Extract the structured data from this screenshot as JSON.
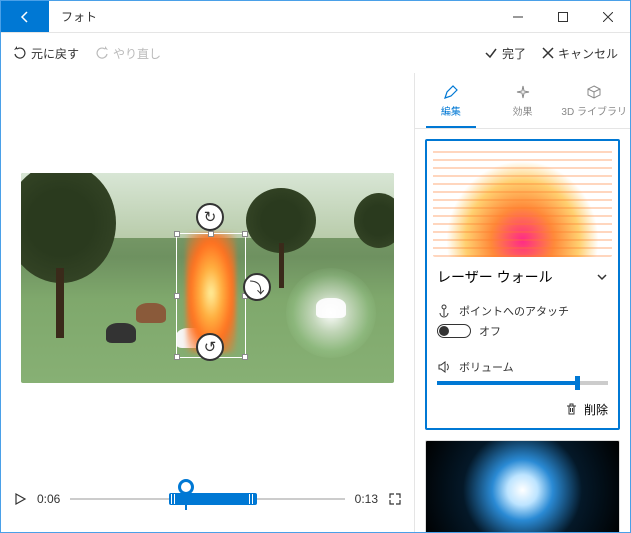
{
  "app": {
    "title": "フォト"
  },
  "toolbar": {
    "undo": "元に戻す",
    "redo": "やり直し",
    "done": "完了",
    "cancel": "キャンセル"
  },
  "playback": {
    "current_time": "0:06",
    "total_time": "0:13"
  },
  "side_tabs": {
    "edit": "編集",
    "effects": "効果",
    "library3d": "3D ライブラリ"
  },
  "effect": {
    "name": "レーザー ウォール",
    "attach_label": "ポイントへのアタッチ",
    "toggle_state": "オフ",
    "volume_label": "ボリューム",
    "volume_percent": 82,
    "delete_label": "削除"
  }
}
